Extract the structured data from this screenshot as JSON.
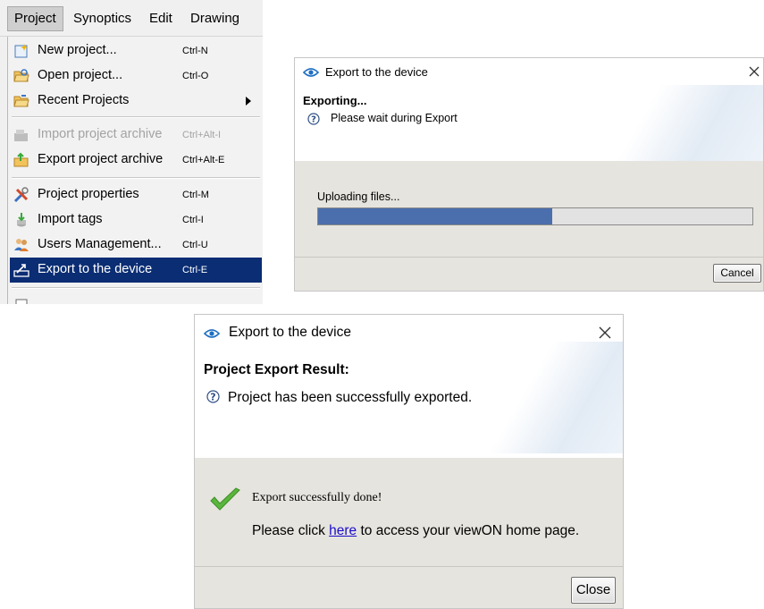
{
  "menubar": {
    "items": [
      {
        "label": "Project"
      },
      {
        "label": "Synoptics"
      },
      {
        "label": "Edit"
      },
      {
        "label": "Drawing"
      }
    ]
  },
  "project_menu": {
    "items": [
      {
        "label": "New project...",
        "shortcut": "Ctrl-N",
        "icon": "new-project-icon"
      },
      {
        "label": "Open project...",
        "shortcut": "Ctrl-O",
        "icon": "open-folder-icon"
      },
      {
        "label": "Recent Projects",
        "shortcut": "",
        "icon": "recent-folder-icon",
        "submenu": true
      },
      {
        "label": "Import project archive",
        "shortcut": "Ctrl+Alt-I",
        "icon": "import-archive-icon",
        "disabled": true
      },
      {
        "label": "Export project archive",
        "shortcut": "Ctrl+Alt-E",
        "icon": "export-archive-icon"
      },
      {
        "label": "Project properties",
        "shortcut": "Ctrl-M",
        "icon": "tools-icon"
      },
      {
        "label": "Import tags",
        "shortcut": "Ctrl-I",
        "icon": "import-tags-icon"
      },
      {
        "label": "Users Management...",
        "shortcut": "Ctrl-U",
        "icon": "users-icon"
      },
      {
        "label": "Export to the device",
        "shortcut": "Ctrl-E",
        "icon": "export-device-icon",
        "selected": true
      }
    ]
  },
  "export_progress_dialog": {
    "title": "Export to the device",
    "heading": "Exporting...",
    "message": "Please wait during Export",
    "status": "Uploading files...",
    "progress": 0.54,
    "cancel_label": "Cancel"
  },
  "export_result_dialog": {
    "title": "Export to the device",
    "heading": "Project Export Result:",
    "message": "Project has been successfully exported.",
    "success_text": "Export successfully done!",
    "link_prefix": "Please click ",
    "link_text": "here",
    "link_suffix": " to access your viewON home page.",
    "close_label": "Close"
  },
  "colors": {
    "selection": "#0a2d73",
    "progress_fill": "#4b6fad",
    "link": "#1a0dcc",
    "check": "#5ab53c"
  }
}
